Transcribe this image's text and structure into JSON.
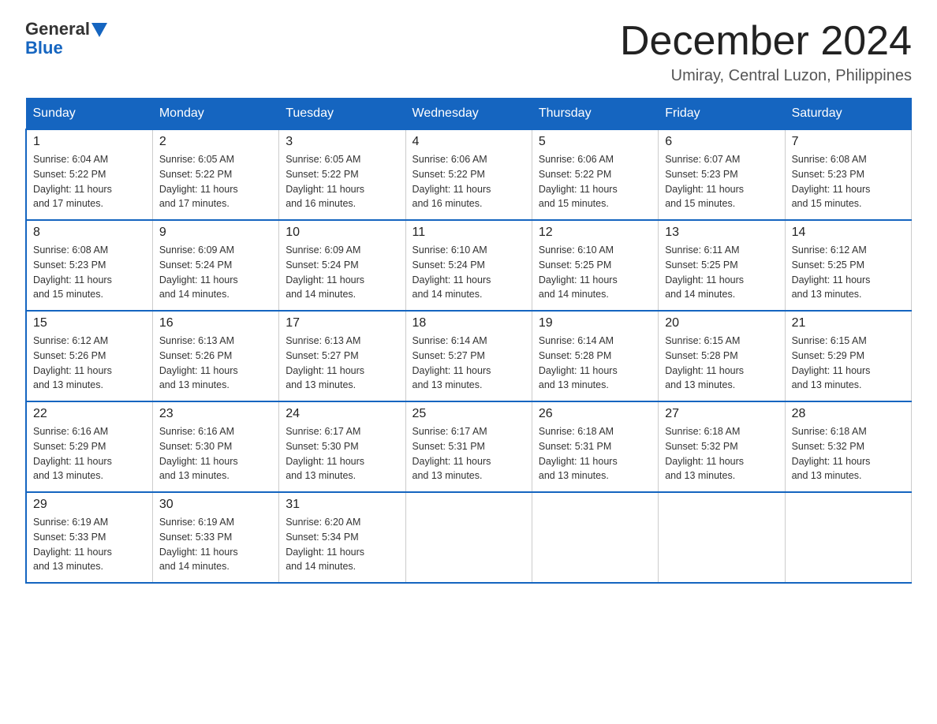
{
  "header": {
    "logo_general": "General",
    "logo_blue": "Blue",
    "month_title": "December 2024",
    "location": "Umiray, Central Luzon, Philippines"
  },
  "weekdays": [
    "Sunday",
    "Monday",
    "Tuesday",
    "Wednesday",
    "Thursday",
    "Friday",
    "Saturday"
  ],
  "weeks": [
    [
      {
        "day": "1",
        "sunrise": "6:04 AM",
        "sunset": "5:22 PM",
        "daylight": "11 hours and 17 minutes."
      },
      {
        "day": "2",
        "sunrise": "6:05 AM",
        "sunset": "5:22 PM",
        "daylight": "11 hours and 17 minutes."
      },
      {
        "day": "3",
        "sunrise": "6:05 AM",
        "sunset": "5:22 PM",
        "daylight": "11 hours and 16 minutes."
      },
      {
        "day": "4",
        "sunrise": "6:06 AM",
        "sunset": "5:22 PM",
        "daylight": "11 hours and 16 minutes."
      },
      {
        "day": "5",
        "sunrise": "6:06 AM",
        "sunset": "5:22 PM",
        "daylight": "11 hours and 15 minutes."
      },
      {
        "day": "6",
        "sunrise": "6:07 AM",
        "sunset": "5:23 PM",
        "daylight": "11 hours and 15 minutes."
      },
      {
        "day": "7",
        "sunrise": "6:08 AM",
        "sunset": "5:23 PM",
        "daylight": "11 hours and 15 minutes."
      }
    ],
    [
      {
        "day": "8",
        "sunrise": "6:08 AM",
        "sunset": "5:23 PM",
        "daylight": "11 hours and 15 minutes."
      },
      {
        "day": "9",
        "sunrise": "6:09 AM",
        "sunset": "5:24 PM",
        "daylight": "11 hours and 14 minutes."
      },
      {
        "day": "10",
        "sunrise": "6:09 AM",
        "sunset": "5:24 PM",
        "daylight": "11 hours and 14 minutes."
      },
      {
        "day": "11",
        "sunrise": "6:10 AM",
        "sunset": "5:24 PM",
        "daylight": "11 hours and 14 minutes."
      },
      {
        "day": "12",
        "sunrise": "6:10 AM",
        "sunset": "5:25 PM",
        "daylight": "11 hours and 14 minutes."
      },
      {
        "day": "13",
        "sunrise": "6:11 AM",
        "sunset": "5:25 PM",
        "daylight": "11 hours and 14 minutes."
      },
      {
        "day": "14",
        "sunrise": "6:12 AM",
        "sunset": "5:25 PM",
        "daylight": "11 hours and 13 minutes."
      }
    ],
    [
      {
        "day": "15",
        "sunrise": "6:12 AM",
        "sunset": "5:26 PM",
        "daylight": "11 hours and 13 minutes."
      },
      {
        "day": "16",
        "sunrise": "6:13 AM",
        "sunset": "5:26 PM",
        "daylight": "11 hours and 13 minutes."
      },
      {
        "day": "17",
        "sunrise": "6:13 AM",
        "sunset": "5:27 PM",
        "daylight": "11 hours and 13 minutes."
      },
      {
        "day": "18",
        "sunrise": "6:14 AM",
        "sunset": "5:27 PM",
        "daylight": "11 hours and 13 minutes."
      },
      {
        "day": "19",
        "sunrise": "6:14 AM",
        "sunset": "5:28 PM",
        "daylight": "11 hours and 13 minutes."
      },
      {
        "day": "20",
        "sunrise": "6:15 AM",
        "sunset": "5:28 PM",
        "daylight": "11 hours and 13 minutes."
      },
      {
        "day": "21",
        "sunrise": "6:15 AM",
        "sunset": "5:29 PM",
        "daylight": "11 hours and 13 minutes."
      }
    ],
    [
      {
        "day": "22",
        "sunrise": "6:16 AM",
        "sunset": "5:29 PM",
        "daylight": "11 hours and 13 minutes."
      },
      {
        "day": "23",
        "sunrise": "6:16 AM",
        "sunset": "5:30 PM",
        "daylight": "11 hours and 13 minutes."
      },
      {
        "day": "24",
        "sunrise": "6:17 AM",
        "sunset": "5:30 PM",
        "daylight": "11 hours and 13 minutes."
      },
      {
        "day": "25",
        "sunrise": "6:17 AM",
        "sunset": "5:31 PM",
        "daylight": "11 hours and 13 minutes."
      },
      {
        "day": "26",
        "sunrise": "6:18 AM",
        "sunset": "5:31 PM",
        "daylight": "11 hours and 13 minutes."
      },
      {
        "day": "27",
        "sunrise": "6:18 AM",
        "sunset": "5:32 PM",
        "daylight": "11 hours and 13 minutes."
      },
      {
        "day": "28",
        "sunrise": "6:18 AM",
        "sunset": "5:32 PM",
        "daylight": "11 hours and 13 minutes."
      }
    ],
    [
      {
        "day": "29",
        "sunrise": "6:19 AM",
        "sunset": "5:33 PM",
        "daylight": "11 hours and 13 minutes."
      },
      {
        "day": "30",
        "sunrise": "6:19 AM",
        "sunset": "5:33 PM",
        "daylight": "11 hours and 14 minutes."
      },
      {
        "day": "31",
        "sunrise": "6:20 AM",
        "sunset": "5:34 PM",
        "daylight": "11 hours and 14 minutes."
      },
      null,
      null,
      null,
      null
    ]
  ],
  "labels": {
    "sunrise": "Sunrise:",
    "sunset": "Sunset:",
    "daylight": "Daylight:"
  }
}
